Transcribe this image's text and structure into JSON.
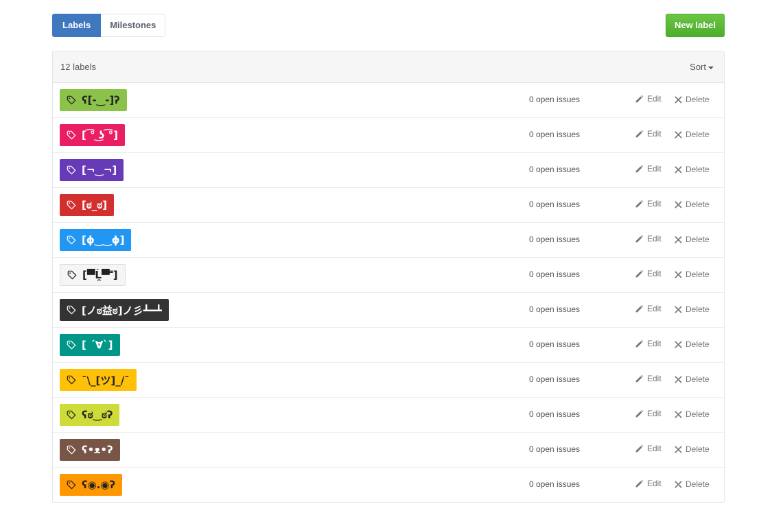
{
  "subnav": {
    "labels_tab": "Labels",
    "milestones_tab": "Milestones"
  },
  "new_label_button": "New label",
  "colors": {
    "accent_blue": "#4078c0",
    "new_button_green": "#6cc644"
  },
  "table": {
    "count_text": "12 labels",
    "sort_label": "Sort"
  },
  "rows": [
    {
      "label": "ʕ[-‿-]ʔ",
      "bg": "#8bc34a",
      "fg": "#222222",
      "issues": "0 open issues",
      "edit": "Edit",
      "delete": "Delete"
    },
    {
      "label": "[ ͡° ͜ʖ ͡°]",
      "bg": "#e91e63",
      "fg": "#ffffff",
      "issues": "0 open issues",
      "edit": "Edit",
      "delete": "Delete"
    },
    {
      "label": "[¬‿¬]",
      "bg": "#673ab7",
      "fg": "#ffffff",
      "issues": "0 open issues",
      "edit": "Edit",
      "delete": "Delete"
    },
    {
      "label": "[ಠ_ಠ]",
      "bg": "#d32f2f",
      "fg": "#ffffff",
      "issues": "0 open issues",
      "edit": "Edit",
      "delete": "Delete"
    },
    {
      "label": "[ɸ‿‿ɸ]",
      "bg": "#2196f3",
      "fg": "#ffffff",
      "issues": "0 open issues",
      "edit": "Edit",
      "delete": "Delete"
    },
    {
      "label": "[▀̿Ĺ̯▀̿ ̿]",
      "bg": "#f5f5f5",
      "fg": "#222222",
      "issues": "0 open issues",
      "edit": "Edit",
      "delete": "Delete"
    },
    {
      "label": "[ノಠ益ಠ]ノ彡┻━┻",
      "bg": "#333333",
      "fg": "#ffffff",
      "issues": "0 open issues",
      "edit": "Edit",
      "delete": "Delete"
    },
    {
      "label": "[ ´∀`]",
      "bg": "#009688",
      "fg": "#ffffff",
      "issues": "0 open issues",
      "edit": "Edit",
      "delete": "Delete"
    },
    {
      "label": "¯\\_[ツ]_/¯",
      "bg": "#ffc107",
      "fg": "#222222",
      "issues": "0 open issues",
      "edit": "Edit",
      "delete": "Delete"
    },
    {
      "label": "ʕಠ‿ಠʔ",
      "bg": "#cddc39",
      "fg": "#222222",
      "issues": "0 open issues",
      "edit": "Edit",
      "delete": "Delete"
    },
    {
      "label": "ʕ•ᴥ•ʔ",
      "bg": "#795548",
      "fg": "#ffffff",
      "issues": "0 open issues",
      "edit": "Edit",
      "delete": "Delete"
    },
    {
      "label": "ʕ◉.◉ʔ",
      "bg": "#ff9800",
      "fg": "#222222",
      "issues": "0 open issues",
      "edit": "Edit",
      "delete": "Delete"
    }
  ]
}
